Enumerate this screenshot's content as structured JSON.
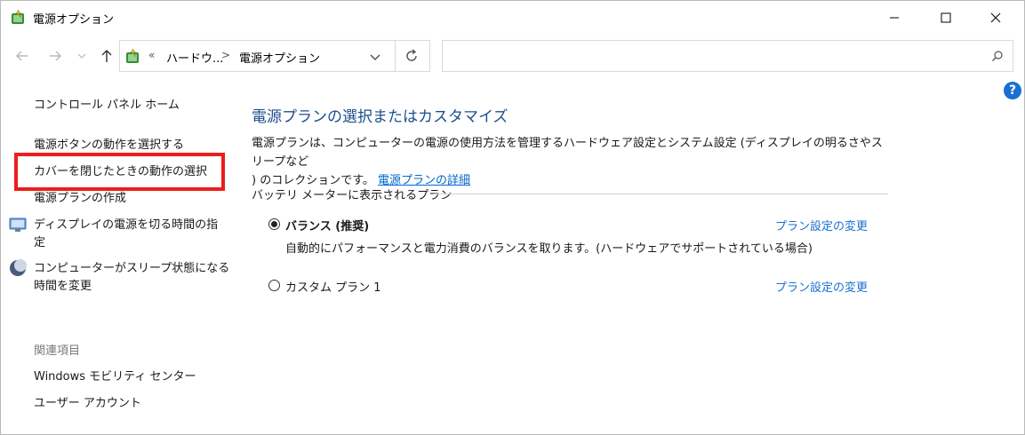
{
  "window": {
    "title": "電源オプション"
  },
  "address_bar": {
    "prefix": "«",
    "crumb1": "ハードウ...",
    "separator": ">",
    "crumb2": "電源オプション"
  },
  "search": {
    "placeholder": ""
  },
  "help": {
    "label": "?"
  },
  "left_pane": {
    "home": "コントロール パネル ホーム",
    "items": [
      "電源ボタンの動作を選択する",
      "カバーを閉じたときの動作の選択",
      "電源プランの作成"
    ],
    "display_off": [
      "ディスプレイの電源を切る時間の指",
      "定"
    ],
    "sleep": [
      "コンピューターがスリープ状態になる",
      "時間を変更"
    ],
    "related_heading": "関連項目",
    "related": [
      "Windows モビリティ センター",
      "ユーザー アカウント"
    ]
  },
  "main": {
    "heading": "電源プランの選択またはカスタマイズ",
    "description_line1": "電源プランは、コンピューターの電源の使用方法を管理するハードウェア設定とシステム設定 (ディスプレイの明るさやスリープなど",
    "description_line2": ") のコレクションです。",
    "details_link": "電源プランの詳細",
    "group_label": "バッテリ メーターに表示されるプラン",
    "plans": [
      {
        "name": "バランス (推奨)",
        "selected": true,
        "description": "自動的にパフォーマンスと電力消費のバランスを取ります。(ハードウェアでサポートされている場合)",
        "link": "プラン設定の変更"
      },
      {
        "name": "カスタム プラン 1",
        "selected": false,
        "description": "",
        "link": "プラン設定の変更"
      }
    ]
  },
  "colors": {
    "highlight": "#ee1c1c",
    "heading": "#1e4e8c",
    "link": "#1a6fd1"
  }
}
